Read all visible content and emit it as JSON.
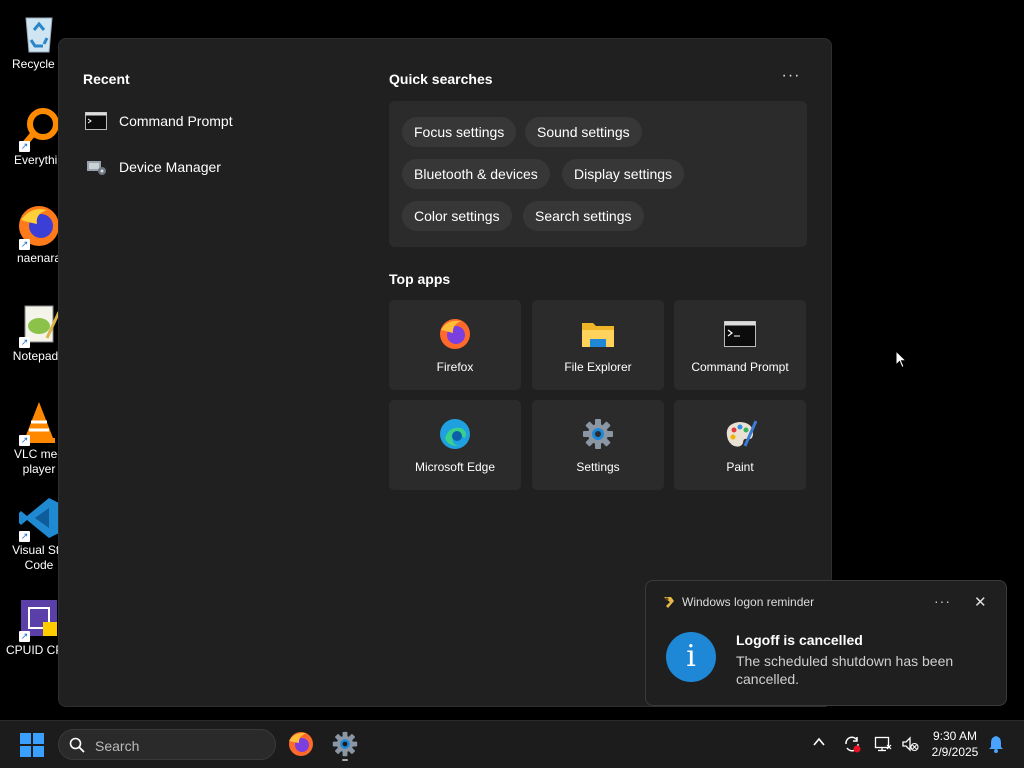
{
  "desktop": {
    "icons": [
      {
        "label": "Recycle B",
        "icon": "recycle-bin-icon"
      },
      {
        "label": "Everythin",
        "icon": "everything-search-icon"
      },
      {
        "label": "naenara",
        "icon": "firefox-icon"
      },
      {
        "label": "Notepad+",
        "icon": "notepad-plus-plus-icon"
      },
      {
        "label": "VLC med\nplayer",
        "icon": "vlc-icon"
      },
      {
        "label": "Visual Stu\nCode",
        "icon": "vscode-icon"
      },
      {
        "label": "CPUID CPU",
        "icon": "cpuid-icon"
      }
    ]
  },
  "start_panel": {
    "recent_title": "Recent",
    "recent": [
      {
        "label": "Command Prompt",
        "icon": "command-prompt-icon"
      },
      {
        "label": "Device Manager",
        "icon": "device-manager-icon"
      }
    ],
    "quick_searches_title": "Quick searches",
    "more_label": "···",
    "quick_searches": [
      "Focus settings",
      "Sound settings",
      "Bluetooth & devices",
      "Display settings",
      "Color settings",
      "Search settings"
    ],
    "top_apps_title": "Top apps",
    "top_apps": [
      {
        "label": "Firefox",
        "icon": "firefox-icon"
      },
      {
        "label": "File Explorer",
        "icon": "folder-icon"
      },
      {
        "label": "Command Prompt",
        "icon": "command-prompt-icon"
      },
      {
        "label": "Microsoft Edge",
        "icon": "edge-icon"
      },
      {
        "label": "Settings",
        "icon": "gear-icon"
      },
      {
        "label": "Paint",
        "icon": "paint-palette-icon"
      }
    ]
  },
  "notification": {
    "app_name": "Windows logon reminder",
    "title": "Logoff is cancelled",
    "body": "The scheduled shutdown has been cancelled.",
    "more_label": "···",
    "close_label": "✕",
    "info_glyph": "i"
  },
  "taskbar": {
    "search_placeholder": "Search",
    "time": "9:30 AM",
    "date": "2/9/2025",
    "tray_chevron": "^"
  },
  "colors": {
    "accent": "#1e88d6",
    "panel_bg": "#202020",
    "chip_bg": "#373737"
  }
}
